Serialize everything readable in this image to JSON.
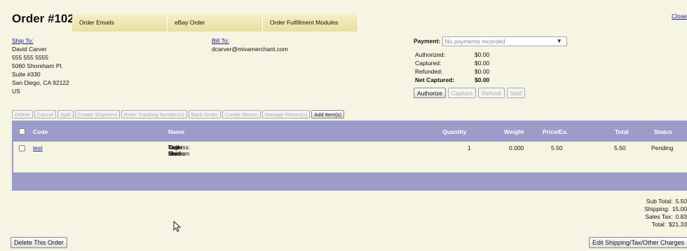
{
  "header": {
    "title": "Order #1027",
    "tabs": [
      "Order Emails",
      "eBay Order",
      "Order Fulfillment Modules"
    ],
    "close_label": "Close"
  },
  "ship_to": {
    "label": "Ship To:",
    "lines": [
      "David Carver",
      "555 555 5555",
      "5060 Shoreham Pl.",
      "Suite #330",
      "San Diego, CA 92122",
      "US"
    ]
  },
  "bill_to": {
    "label": "Bill To:",
    "email": "dcarver@mivamerchant.com"
  },
  "payment": {
    "label": "Payment:",
    "select_value": "No payments recorded",
    "amounts": [
      {
        "label": "Authorized:",
        "value": "$0.00"
      },
      {
        "label": "Captured:",
        "value": "$0.00"
      },
      {
        "label": "Refunded:",
        "value": "$0.00"
      },
      {
        "label": "Net Captured:",
        "value": "$0.00"
      }
    ],
    "buttons": [
      "Authorize",
      "Capture",
      "Refund",
      "Void"
    ]
  },
  "toolbar": {
    "buttons": [
      "Delete",
      "Cancel",
      "Split",
      "Create Shipment",
      "Enter Tracking Number(s)",
      "Back Order",
      "Create Return",
      "Manage Return(s)",
      "Add Item(s)"
    ]
  },
  "grid": {
    "columns": [
      "Code",
      "Name",
      "Quantity",
      "Weight",
      "Price/Ea.",
      "Total",
      "Status"
    ],
    "rows": [
      {
        "code": "test",
        "name": "Test Shirt",
        "options": [
          "Size: Medium",
          "Color: Green",
          "Tagless: Yes"
        ],
        "quantity": "1",
        "weight": "0.000",
        "price": "5.50",
        "total": "5.50",
        "status": "Pending"
      }
    ]
  },
  "totals": [
    {
      "label": "Sub Total:",
      "value": "5.50"
    },
    {
      "label": "Shipping:",
      "value": "15.00"
    },
    {
      "label": "Sales Tax:",
      "value": "0.83"
    },
    {
      "label": "Total:",
      "value": "$21.33"
    }
  ],
  "footer": {
    "delete_order": "Delete This Order",
    "edit_charges": "Edit Shipping/Tax/Other Charges"
  }
}
